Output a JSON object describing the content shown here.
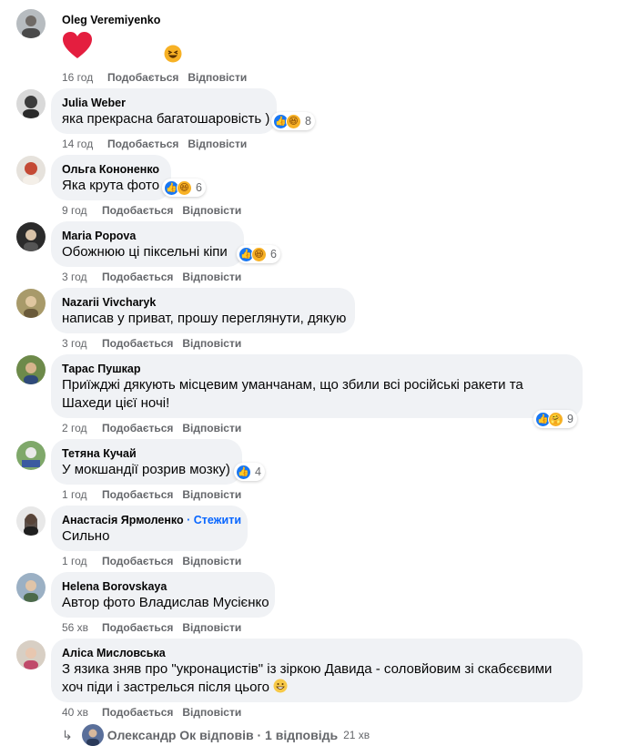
{
  "comments": [
    {
      "author": "Oleg Veremiyenko",
      "text": "",
      "time": "16 год",
      "like": "Подобається",
      "reply": "Відповісти"
    },
    {
      "author": "Julia Weber",
      "text": "яка прекрасна багатошаровість )",
      "time": "14 год",
      "like": "Подобається",
      "reply": "Відповісти",
      "reactions": "8"
    },
    {
      "author": "Ольга Кононенко",
      "text": "Яка крута фото",
      "time": "9 год",
      "like": "Подобається",
      "reply": "Відповісти",
      "reactions": "6"
    },
    {
      "author": "Maria Popova",
      "text": "Обожнюю ці піксельні кіпи",
      "time": "3 год",
      "like": "Подобається",
      "reply": "Відповісти",
      "reactions": "6"
    },
    {
      "author": "Nazarii Vivcharyk",
      "text": "написав у приват, прошу переглянути, дякую",
      "time": "3 год",
      "like": "Подобається",
      "reply": "Відповісти"
    },
    {
      "author": "Тарас Пушкар",
      "text_line1": "Приїжджі дякують місцевим уманчанам, що збили всі російські ракети та",
      "text_line2": "Шахеди цієї ночі!",
      "time": "2 год",
      "like": "Подобається",
      "reply": "Відповісти",
      "reactions": "9"
    },
    {
      "author": "Тетяна Кучай",
      "text": "У мокшандії розрив мозку)",
      "time": "1 год",
      "like": "Подобається",
      "reply": "Відповісти",
      "reactions": "4"
    },
    {
      "author": "Анастасія Ярмоленко",
      "follow": "· Стежити",
      "text": "Сильно",
      "time": "1 год",
      "like": "Подобається",
      "reply": "Відповісти"
    },
    {
      "author": "Helena Borovskaya",
      "text": "Автор фото Владислав Мусієнко",
      "time": "56 хв",
      "like": "Подобається",
      "reply": "Відповісти"
    },
    {
      "author": "Аліса Мисловська",
      "text_line1": "З язика зняв про \"укронацистів\" із зіркою Давида - соловйовим зі скабєєвими",
      "text_line2": "хоч піди і застрелься після цього",
      "time": "40 хв",
      "like": "Подобається",
      "reply": "Відповісти"
    }
  ],
  "reply_summary": {
    "name": "Олександр Ок",
    "action": "відповів",
    "sep": "·",
    "count": "1 відповідь",
    "time": "21 хв"
  },
  "colors": {
    "bubble": "#f0f2f5",
    "meta": "#65676b",
    "accent": "#0866ff",
    "like": "#1877f2",
    "haha": "#f7b125",
    "heart": "#e41e3f"
  },
  "icons": [
    "heart-icon",
    "haha-icon",
    "like-icon",
    "care-icon",
    "reply-arrow-icon"
  ]
}
